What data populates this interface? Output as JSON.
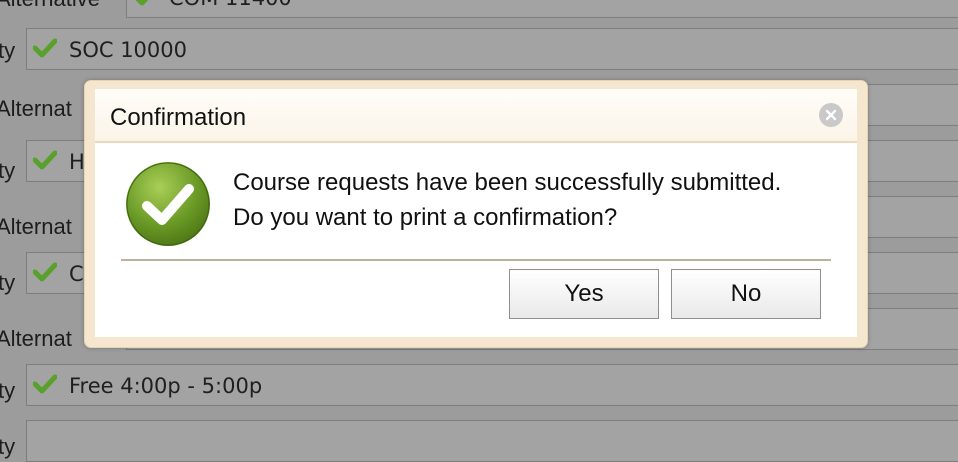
{
  "background_rows": [
    {
      "label": "Alternative",
      "kind": "alt",
      "value": "COM 11400",
      "checked": true
    },
    {
      "label": "ty",
      "kind": "main",
      "value": "SOC 10000",
      "checked": true
    },
    {
      "label": "Alternat",
      "kind": "alt",
      "value": "",
      "checked": false
    },
    {
      "label": "ty",
      "kind": "main",
      "value": "H",
      "checked": true
    },
    {
      "label": "Alternat",
      "kind": "alt",
      "value": "",
      "checked": false
    },
    {
      "label": "ty",
      "kind": "main",
      "value": "C",
      "checked": true
    },
    {
      "label": "Alternat",
      "kind": "alt",
      "value": "",
      "checked": false
    },
    {
      "label": "ty",
      "kind": "main",
      "value": "Free 4:00p - 5:00p",
      "checked": true
    },
    {
      "label": "ty",
      "kind": "main",
      "value": "",
      "checked": false
    }
  ],
  "dialog": {
    "title": "Confirmation",
    "close_icon": "close-icon",
    "status_icon": "check-circle-icon",
    "message_line1": "Course requests have been successfully submitted.",
    "message_line2": "Do you want to print a confirmation?",
    "yes_label": "Yes",
    "no_label": "No"
  },
  "colors": {
    "check_green": "#5aa02c",
    "dialog_frame": "#f5e7cf",
    "overlay": "#9c9c9c"
  }
}
